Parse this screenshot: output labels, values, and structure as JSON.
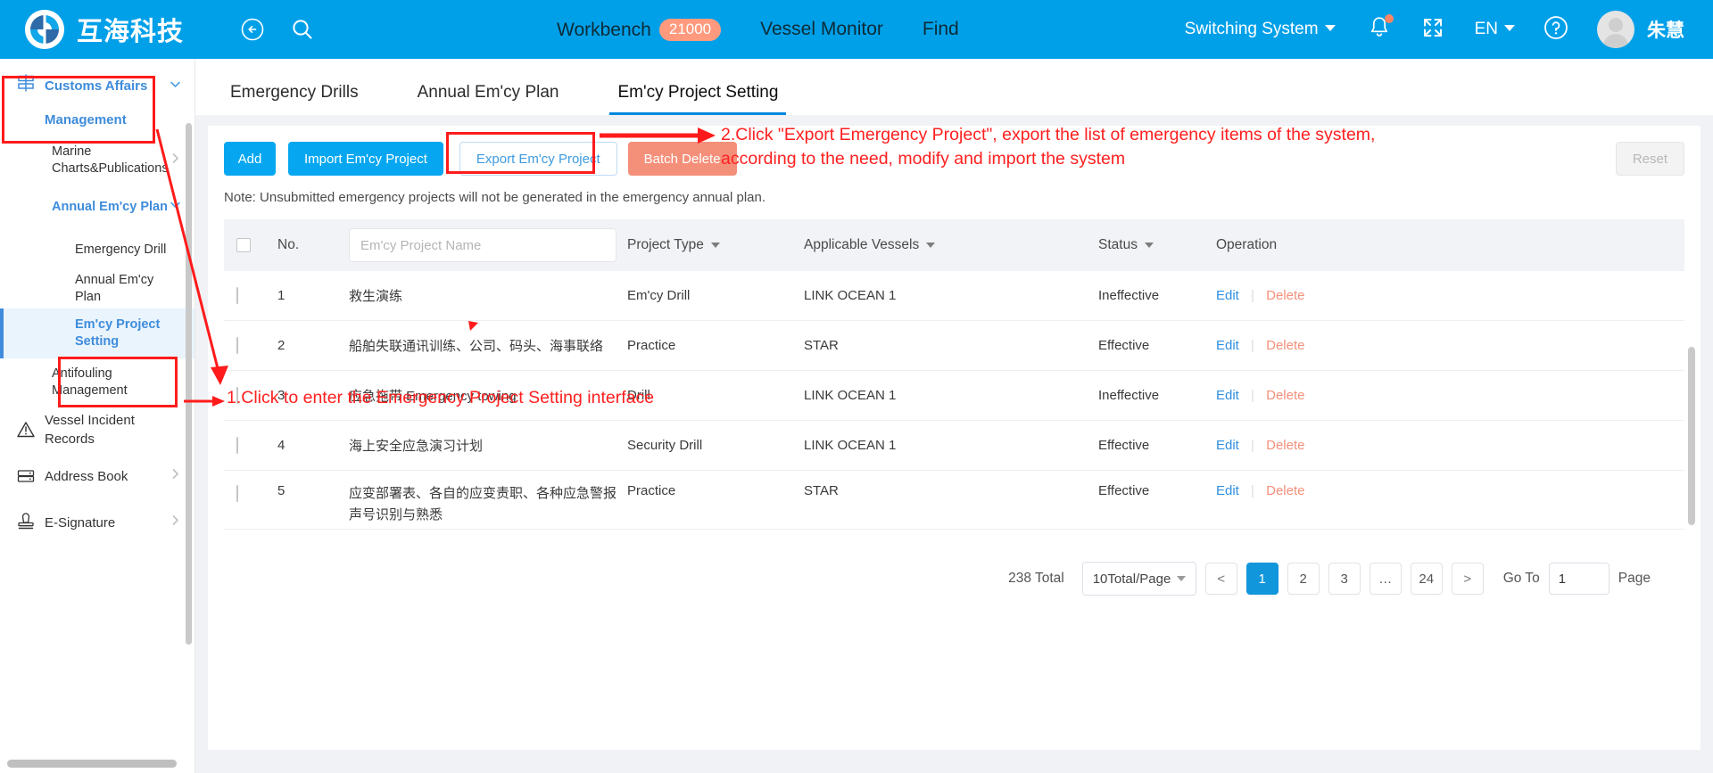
{
  "header": {
    "brand_name": "互海科技",
    "back_icon": "back-arrow-icon",
    "search_icon": "search-icon",
    "nav": [
      {
        "label": "Workbench",
        "badge": "21000"
      },
      {
        "label": "Vessel Monitor",
        "badge": ""
      },
      {
        "label": "Find",
        "badge": ""
      }
    ],
    "switching_system": "Switching System",
    "language": "EN",
    "user_name": "朱慧",
    "bell_icon": "bell-icon",
    "fullscreen_icon": "fullscreen-icon",
    "help_icon": "question-mark-icon",
    "accent_color": "#00A0E9",
    "badge_color": "#FF9A7E"
  },
  "sidebar": {
    "top_item": {
      "label": "Customs Affairs Management",
      "icon": "customs-sign-icon",
      "expanded": true
    },
    "children": [
      {
        "label": "Marine Charts&Publications",
        "has_arrow": true,
        "active": false
      },
      {
        "label": "Annual Em'cy Plan",
        "has_arrow": true,
        "active": true,
        "highlight": true
      }
    ],
    "grandchildren": [
      {
        "label": "Emergency Drill",
        "active": false
      },
      {
        "label": "Annual Em'cy Plan",
        "active": false
      },
      {
        "label": "Em'cy Project Setting",
        "active": true
      }
    ],
    "after": [
      {
        "label": "Antifouling Management",
        "icon": "",
        "has_arrow": false
      },
      {
        "label": "Vessel Incident Records",
        "icon": "warning-triangle-icon",
        "has_arrow": false
      },
      {
        "label": "Address Book",
        "icon": "address-book-icon",
        "has_arrow": true
      },
      {
        "label": "E-Signature",
        "icon": "stamp-icon",
        "has_arrow": true
      }
    ]
  },
  "tabs": [
    {
      "label": "Emergency Drills",
      "active": false
    },
    {
      "label": "Annual Em'cy Plan",
      "active": false
    },
    {
      "label": "Em'cy Project Setting",
      "active": true
    }
  ],
  "toolbar": {
    "add": "Add",
    "import": "Import Em'cy Project",
    "export": "Export Em'cy Project",
    "batch_delete": "Batch Delete",
    "reset": "Reset"
  },
  "note": "Note: Unsubmitted emergency projects will not be generated in the emergency annual plan.",
  "table": {
    "headers": {
      "no": "No.",
      "name_placeholder": "Em'cy Project Name",
      "type": "Project Type",
      "vessels": "Applicable Vessels",
      "status": "Status",
      "operation": "Operation"
    },
    "rows": [
      {
        "no": "1",
        "name": "救生演练",
        "type": "Em'cy Drill",
        "vessel": "LINK OCEAN 1",
        "status": "Ineffective",
        "edit": "Edit",
        "delete": "Delete"
      },
      {
        "no": "2",
        "name": "船舶失联通讯训练、公司、码头、海事联络",
        "type": "Practice",
        "vessel": "STAR",
        "status": "Effective",
        "edit": "Edit",
        "delete": "Delete"
      },
      {
        "no": "3",
        "name": "应急拖带 Emergency towing",
        "type": "Drill",
        "vessel": "LINK OCEAN 1",
        "status": "Ineffective",
        "edit": "Edit",
        "delete": "Delete"
      },
      {
        "no": "4",
        "name": "海上安全应急演习计划",
        "type": "Security Drill",
        "vessel": "LINK OCEAN 1",
        "status": "Effective",
        "edit": "Edit",
        "delete": "Delete"
      },
      {
        "no": "5",
        "name": "应变部署表、各自的应变责职、各种应急警报声号识别与熟悉",
        "type": "Practice",
        "vessel": "STAR",
        "status": "Effective",
        "edit": "Edit",
        "delete": "Delete"
      }
    ]
  },
  "pagination": {
    "total": "238 Total",
    "page_size": "10Total/Page",
    "prev": "<",
    "next": ">",
    "pages": [
      "1",
      "2",
      "3",
      "…",
      "24"
    ],
    "current_page": "1",
    "goto_label": "Go To",
    "goto_value": "1",
    "page_label": "Page"
  },
  "annotations": {
    "step1": "1.Click to enter the Emergency Project Setting interface",
    "step2_line1": "2.Click \"Export Emergency Project\", export the list of emergency items of the system,",
    "step2_line2": "according to the need, modify and import the system",
    "color": "#FF2020"
  }
}
